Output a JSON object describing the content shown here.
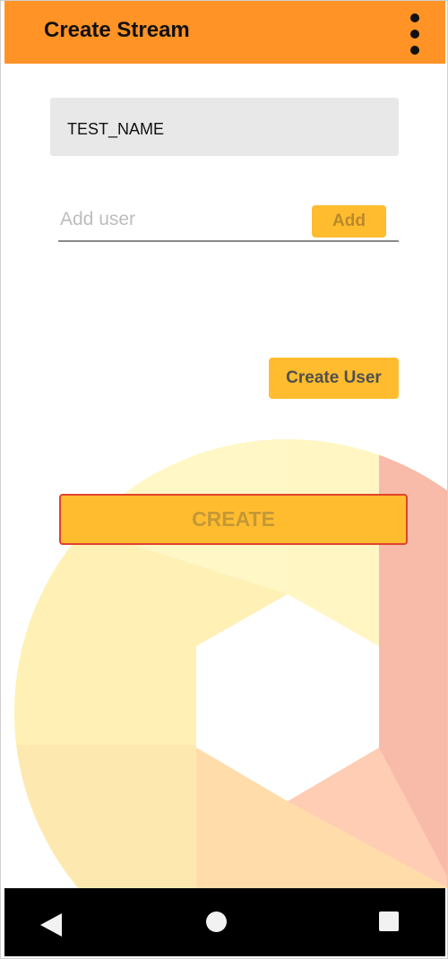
{
  "app_bar": {
    "title": "Create Stream",
    "menu_icon": "more-vert-icon",
    "color": "#ff9326"
  },
  "form": {
    "stream_name_value": "TEST_NAME",
    "add_user_placeholder": "Add user",
    "add_user_value": "",
    "add_button_label": "Add",
    "create_user_button_label": "Create User",
    "create_button_label": "CREATE"
  },
  "colors": {
    "accent": "#ffbc2f",
    "create_border": "#e0432d"
  },
  "nav_bar": {
    "back_icon": "back-triangle-icon",
    "home_icon": "home-circle-icon",
    "recents_icon": "recents-square-icon"
  }
}
